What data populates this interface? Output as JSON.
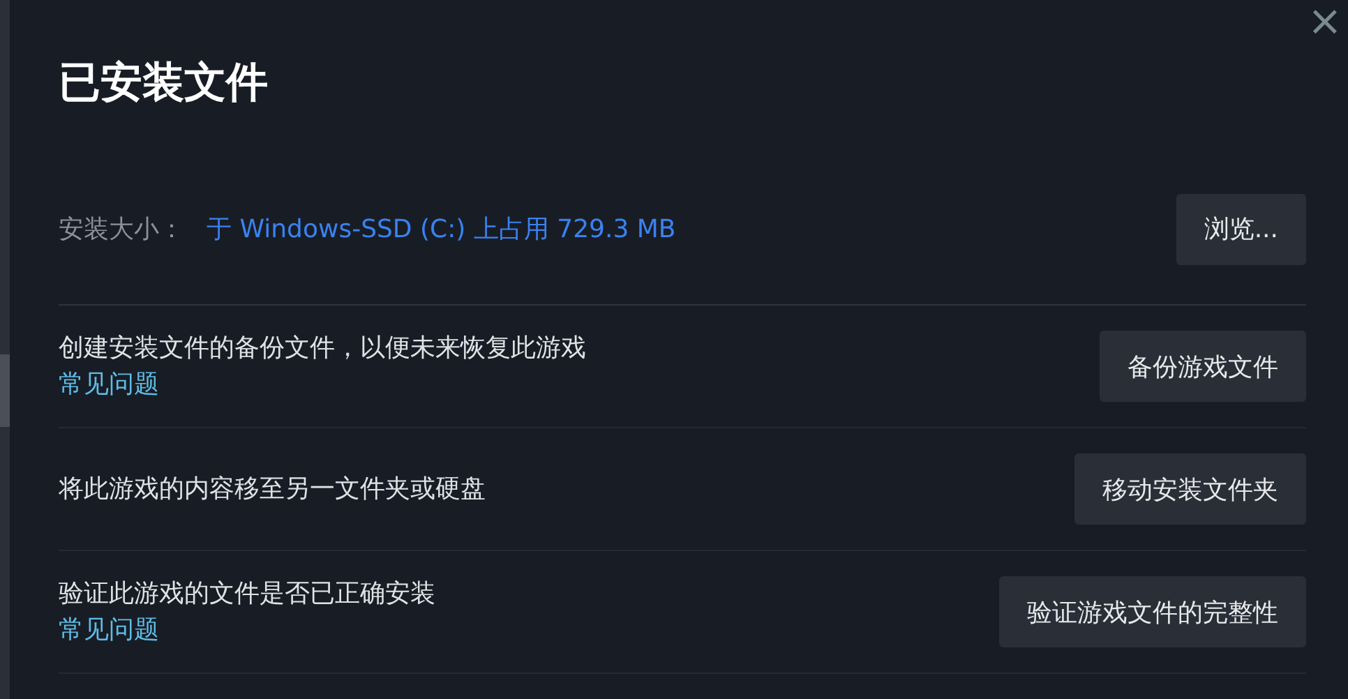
{
  "dialog": {
    "title": "已安装文件",
    "close_icon": "×"
  },
  "install_size": {
    "label": "安装大小：",
    "value": "于 Windows-SSD (C:) 上占用 729.3 MB",
    "button": "浏览..."
  },
  "actions": [
    {
      "description": "创建安装文件的备份文件，以便未来恢复此游戏",
      "link": "常见问题",
      "button": "备份游戏文件"
    },
    {
      "description": "将此游戏的内容移至另一文件夹或硬盘",
      "button": "移动安装文件夹"
    },
    {
      "description": "验证此游戏的文件是否已正确安装",
      "link": "常见问题",
      "button": "验证游戏文件的完整性"
    }
  ]
}
